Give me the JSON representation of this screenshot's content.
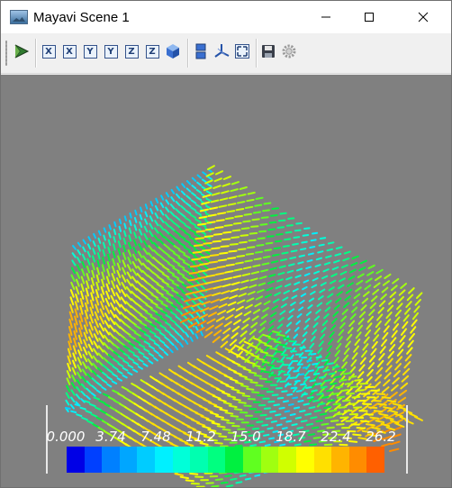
{
  "window": {
    "title": "Mayavi Scene 1",
    "controls": [
      "minimize-icon",
      "maximize-icon",
      "close-icon"
    ]
  },
  "toolbar": {
    "groups": [
      [
        "mayavi-pipeline-icon"
      ],
      [
        "view-x-neg",
        "view-x-pos",
        "view-y-neg",
        "view-y-pos",
        "view-z-neg",
        "view-z-pos",
        "isometric-view-icon"
      ],
      [
        "toggle-parallel-projection-icon",
        "toggle-axes-indicator-icon",
        "full-screen-icon"
      ],
      [
        "save-icon",
        "configure-scene-icon"
      ]
    ],
    "axis_buttons": [
      "X",
      "X",
      "Y",
      "Y",
      "Z",
      "Z"
    ]
  },
  "scene": {
    "background_color": "#808080",
    "content": "3D vector field glyph plot colored by magnitude"
  },
  "colorbar": {
    "labels": [
      "0.000",
      "3.74",
      "7.48",
      "11.2",
      "15.0",
      "18.7",
      "22.4",
      "26.2"
    ],
    "min": 0.0,
    "max": 26.2,
    "colormap": "jet",
    "colors": [
      "#0000e6",
      "#0040ff",
      "#0080ff",
      "#00a6ff",
      "#00ccff",
      "#00f0ff",
      "#00ffd9",
      "#00ffb0",
      "#00ff80",
      "#00f040",
      "#60ff20",
      "#a0ff10",
      "#d0ff00",
      "#ffff00",
      "#ffe000",
      "#ffb400",
      "#ff8c00",
      "#ff6000"
    ]
  }
}
